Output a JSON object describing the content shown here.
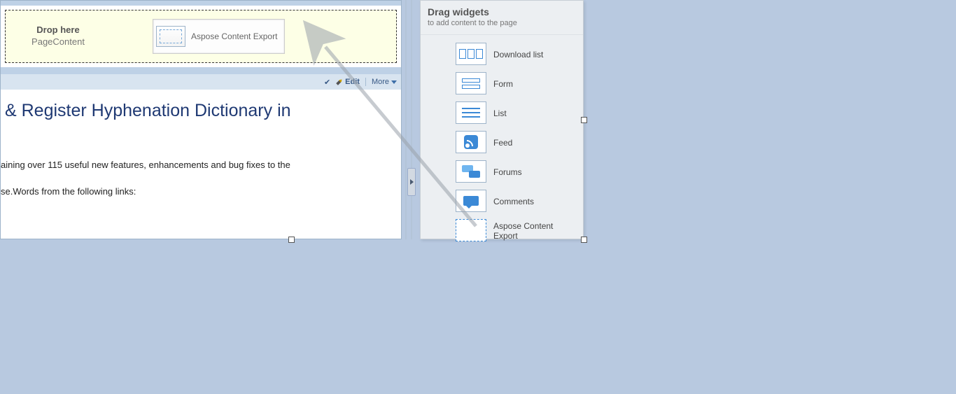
{
  "dropzone": {
    "title": "Drop here",
    "subtitle": "PageContent",
    "dragged_widget_label": "Aspose Content Export"
  },
  "toolbar": {
    "edit_label": "Edit",
    "more_label": "More"
  },
  "content": {
    "headline": " & Register Hyphenation Dictionary in",
    "line1": "aining over 115 useful new features, enhancements and bug fixes to the",
    "line2": "se.Words from the following links:"
  },
  "widgets_panel": {
    "title": "Drag widgets",
    "subtitle": "to add content to the page",
    "items": [
      {
        "label": "Download list"
      },
      {
        "label": "Form"
      },
      {
        "label": "List"
      },
      {
        "label": "Feed"
      },
      {
        "label": "Forums"
      },
      {
        "label": "Comments"
      },
      {
        "label": "Aspose Content Export"
      }
    ]
  }
}
